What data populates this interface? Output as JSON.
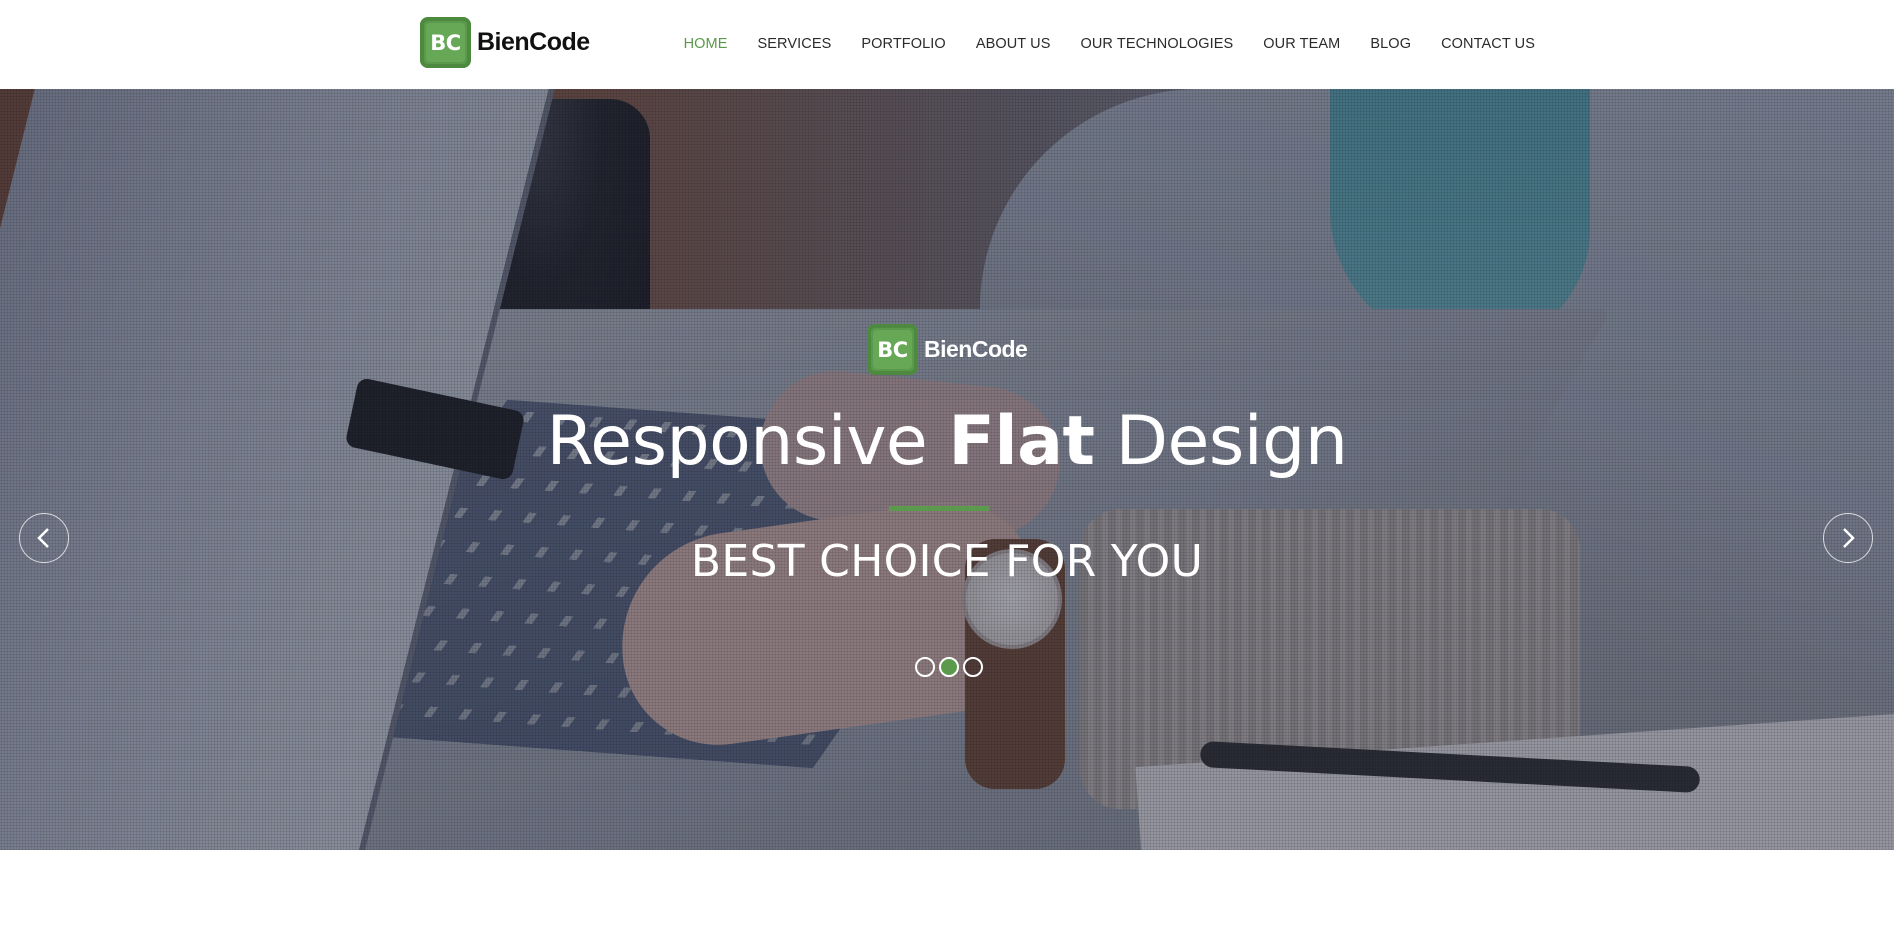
{
  "brand": {
    "badge_text": "BC",
    "name": "BienCode",
    "accent_color": "#5b9a4c"
  },
  "nav": {
    "items": [
      {
        "label": "HOME",
        "active": true
      },
      {
        "label": "SERVICES",
        "active": false
      },
      {
        "label": "PORTFOLIO",
        "active": false
      },
      {
        "label": "ABOUT US",
        "active": false
      },
      {
        "label": "OUR TECHNOLOGIES",
        "active": false
      },
      {
        "label": "OUR TEAM",
        "active": false
      },
      {
        "label": "BLOG",
        "active": false
      },
      {
        "label": "CONTACT US",
        "active": false
      }
    ]
  },
  "hero": {
    "badge_text": "BC",
    "brand_name": "BienCode",
    "title_part1": "Responsive ",
    "title_bold": "Flat",
    "title_part2": " Design",
    "subtitle": "BEST CHOICE FOR YOU",
    "slides": {
      "count": 3,
      "active_index": 1
    },
    "prev_icon": "chevron-left-icon",
    "next_icon": "chevron-right-icon"
  }
}
